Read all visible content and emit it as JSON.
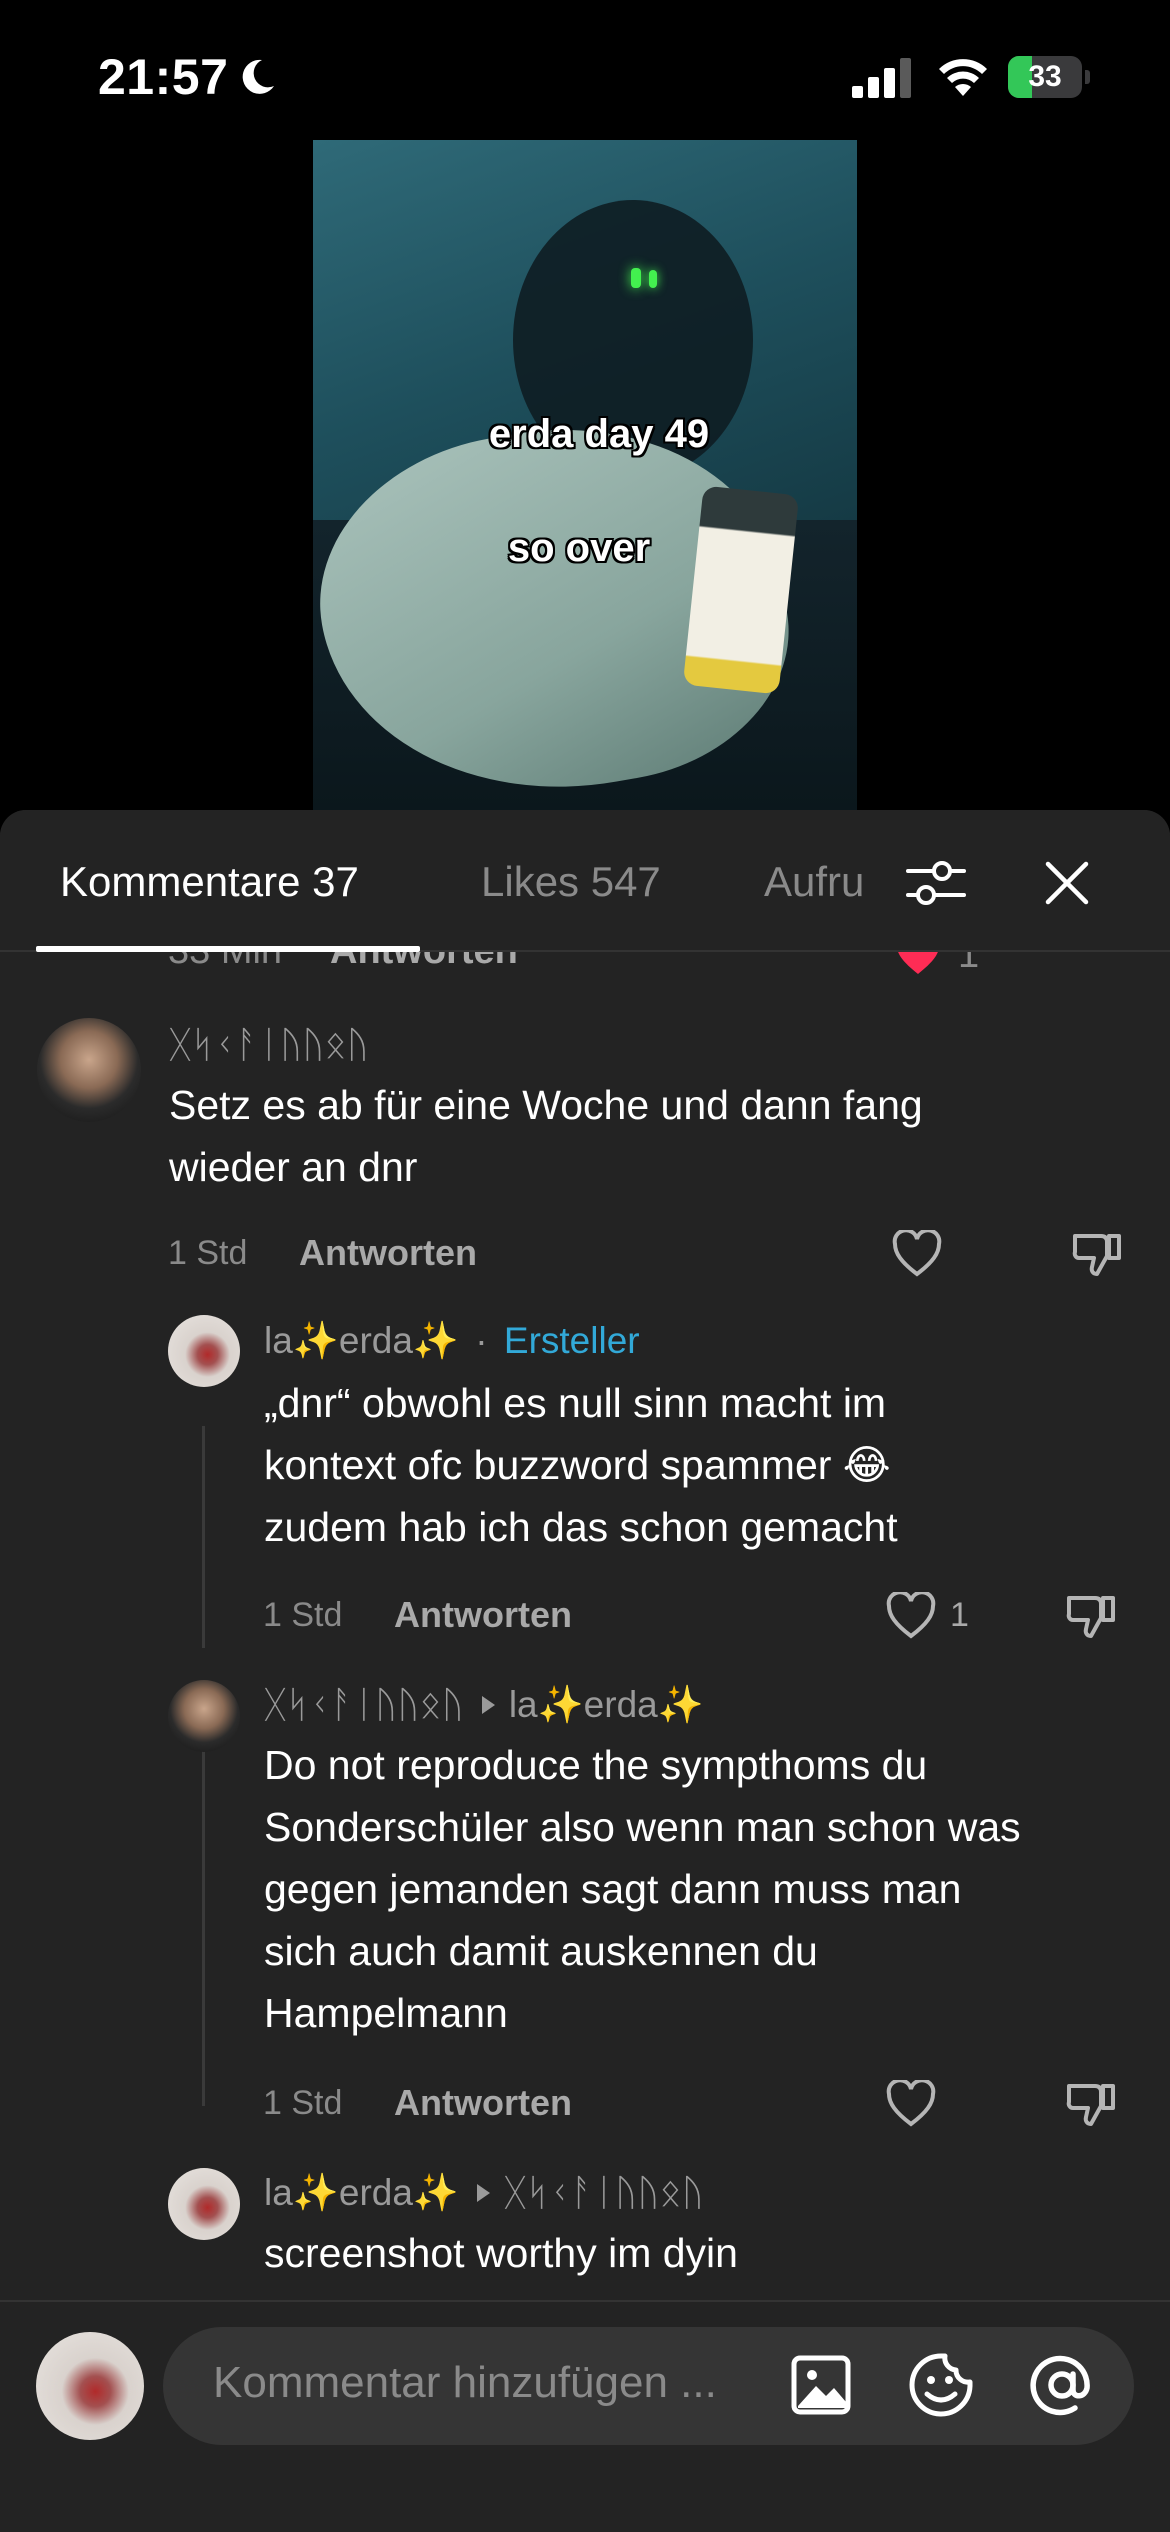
{
  "status_bar": {
    "time": "21:57",
    "battery_level": "33",
    "battery_fraction": 0.33
  },
  "video": {
    "caption_line_1": "erda day 49",
    "caption_line_2": "so over"
  },
  "tabs": [
    {
      "label": "Kommentare 37",
      "active": true
    },
    {
      "label": "Likes 547",
      "active": false
    },
    {
      "label": "Aufru",
      "active": false
    }
  ],
  "partial_row": {
    "time": "33 Min",
    "reply": "Antworten",
    "like_count": "1"
  },
  "comments": [
    {
      "username": "ᚷᛋᚲᚨᛁᚢᚢᛟᚢ",
      "text_line_1": "Setz es ab für eine Woche und dann fang",
      "text_line_2": "wieder an dnr",
      "time": "1 Std",
      "reply_label": "Antworten",
      "like_count": ""
    },
    {
      "username": "la✨erda✨",
      "creator_label": "Ersteller",
      "separator": "·",
      "text_line_1": "„dnr“ obwohl es null sinn macht im",
      "text_line_2": "kontext ofc buzzword spammer 😂",
      "text_line_3": "zudem hab ich das schon gemacht",
      "time": "1 Std",
      "reply_label": "Antworten",
      "like_count": "1"
    },
    {
      "username": "ᚷᛋᚲᚨᛁᚢᚢᛟᚢ",
      "reply_to": "la✨erda✨",
      "text_line_1": "Do not reproduce the sympthoms du",
      "text_line_2": "Sonderschüler also wenn man schon was",
      "text_line_3": "gegen jemanden sagt dann muss man",
      "text_line_4": "sich auch damit auskennen du",
      "text_line_5": "Hampelmann",
      "time": "1 Std",
      "reply_label": "Antworten",
      "like_count": ""
    },
    {
      "username": "la✨erda✨",
      "reply_to": "ᚷᛋᚲᚨᛁᚢᚢᛟᚢ",
      "text_line_1": "screenshot worthy im dyin"
    }
  ],
  "input": {
    "placeholder": "Kommentar hinzufügen ..."
  },
  "colors": {
    "background": "#000000",
    "sheet": "#232323",
    "creator_badge": "#32a9d8",
    "like_red": "#fe2c55",
    "battery_green": "#33c758"
  },
  "icons": [
    "moon-icon",
    "cellular-signal-icon",
    "wifi-icon",
    "battery-icon",
    "filter-sliders-icon",
    "close-icon",
    "heart-icon",
    "dislike-icon",
    "image-icon",
    "emoji-icon",
    "mention-icon"
  ]
}
